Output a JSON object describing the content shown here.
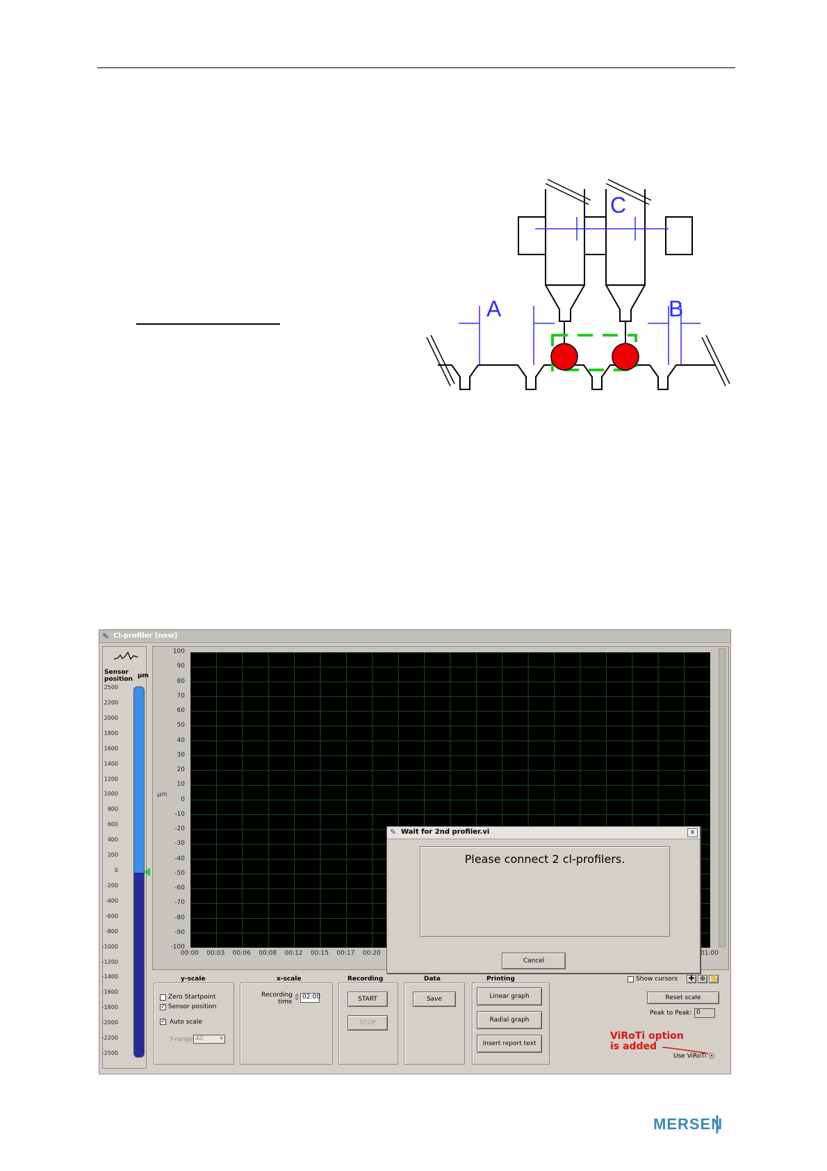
{
  "diagram": {
    "labels": [
      "A",
      "B",
      "C"
    ]
  },
  "app": {
    "title": "Cl-profiler [new]",
    "sensor": {
      "title_line1": "Sensor",
      "title_line2": "position",
      "unit": "µm",
      "ticks": [
        "2500",
        "2200",
        "2000",
        "1800",
        "1600",
        "1400",
        "1200",
        "1000",
        "800",
        "600",
        "400",
        "200",
        "0",
        "-200",
        "-400",
        "-600",
        "-800",
        "-1000",
        "-1200",
        "-1400",
        "-1600",
        "-1800",
        "-2000",
        "-2200",
        "-2500"
      ],
      "level": 0
    },
    "graph": {
      "y_unit": "µm",
      "y_ticks": [
        "100",
        "90",
        "80",
        "70",
        "60",
        "50",
        "40",
        "30",
        "20",
        "10",
        "0",
        "-10",
        "-20",
        "-30",
        "-40",
        "-50",
        "-60",
        "-70",
        "-80",
        "-90",
        "-100"
      ],
      "x_ticks_left": [
        "00:00",
        "00:03",
        "00:06",
        "00:08",
        "00:12",
        "00:15",
        "00:17",
        "00:20"
      ],
      "x_tick_right": "01:00"
    },
    "dialog": {
      "title": "Wait for 2nd profiler.vi",
      "close": "x",
      "message": "Please connect 2 cl-profilers.",
      "cancel": "Cancel"
    },
    "yscale": {
      "title": "y-scale",
      "zero_startpoint": "Zero Startpoint",
      "sensor_position": "Sensor position",
      "auto_scale": "Auto scale",
      "y_range_label": "Y-range",
      "y_range_value": "40"
    },
    "xscale": {
      "title": "x-scale",
      "recording_label_1": "Recording",
      "recording_label_2": "time",
      "recording_value": "02:00"
    },
    "recording": {
      "title": "Recording",
      "start": "START",
      "stop": "STOP"
    },
    "data_group": {
      "title": "Data",
      "save": "Save"
    },
    "printing": {
      "title": "Printing",
      "linear": "Linear graph",
      "radial": "Radial graph",
      "insert": "Insert report text"
    },
    "right": {
      "show_cursors": "Show cursors",
      "reset_scale": "Reset scale",
      "peak_label": "Peak to Peak:",
      "peak_value": "0",
      "viroti_label": "Use ViRoTi",
      "annotation_line1": "ViRoTi option",
      "annotation_line2": "is added"
    }
  },
  "logo": {
    "text": "MERSEN"
  }
}
